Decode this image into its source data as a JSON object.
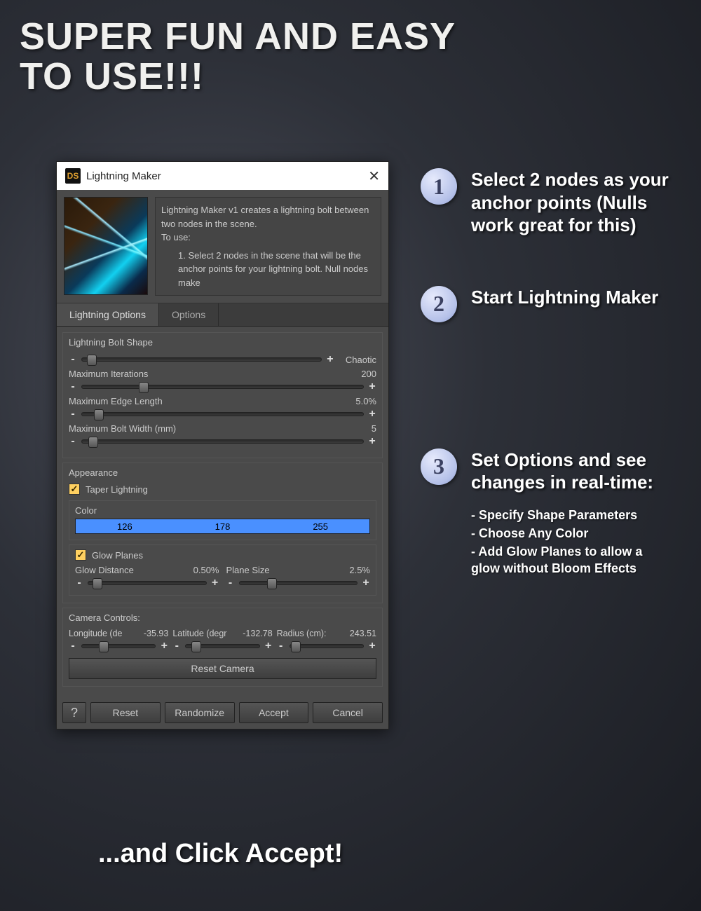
{
  "headline_line1": "SUPER FUN AND EASY",
  "headline_line2": "TO USE!!!",
  "dialog": {
    "icon_text": "DS",
    "title": "Lightning Maker",
    "close": "✕",
    "info": {
      "line1": "Lightning Maker v1 creates a lightning bolt between two nodes in the scene.",
      "line2": "To use:",
      "step1": "1. Select 2 nodes in the scene that will be the anchor points for your lightning bolt. Null nodes make"
    },
    "tabs": {
      "lightning": "Lightning Options",
      "options": "Options"
    },
    "shape_group": "Lightning Bolt Shape",
    "shape_right": "Chaotic",
    "max_iter_label": "Maximum Iterations",
    "max_iter_value": "200",
    "max_edge_label": "Maximum Edge Length",
    "max_edge_value": "5.0%",
    "max_width_label": "Maximum Bolt Width (mm)",
    "max_width_value": "5",
    "appearance_group": "Appearance",
    "taper_label": "Taper Lightning",
    "color_group": "Color",
    "color_r": "126",
    "color_g": "178",
    "color_b": "255",
    "glow_label": "Glow Planes",
    "glow_dist_label": "Glow Distance",
    "glow_dist_value": "0.50%",
    "plane_size_label": "Plane Size",
    "plane_size_value": "2.5%",
    "cam_group": "Camera Controls:",
    "cam_lon_label": "Longitude (de",
    "cam_lon_value": "-35.93",
    "cam_lat_label": "Latitude (degr",
    "cam_lat_value": "-132.78",
    "cam_rad_label": "Radius (cm):",
    "cam_rad_value": "243.51",
    "reset_cam": "Reset Camera",
    "btn_reset": "Reset",
    "btn_random": "Randomize",
    "btn_accept": "Accept",
    "btn_cancel": "Cancel"
  },
  "steps": {
    "s1_num": "1",
    "s1_text": "Select 2 nodes as your anchor points (Nulls work great for this)",
    "s2_num": "2",
    "s2_text": "Start Lightning Maker",
    "s3_num": "3",
    "s3_text": "Set Options and see changes in real-time:",
    "s3_sub1": "- Specify Shape Parameters",
    "s3_sub2": "- Choose Any Color",
    "s3_sub3": "- Add Glow Planes to allow a glow without Bloom Effects"
  },
  "footer": "...and Click Accept!"
}
